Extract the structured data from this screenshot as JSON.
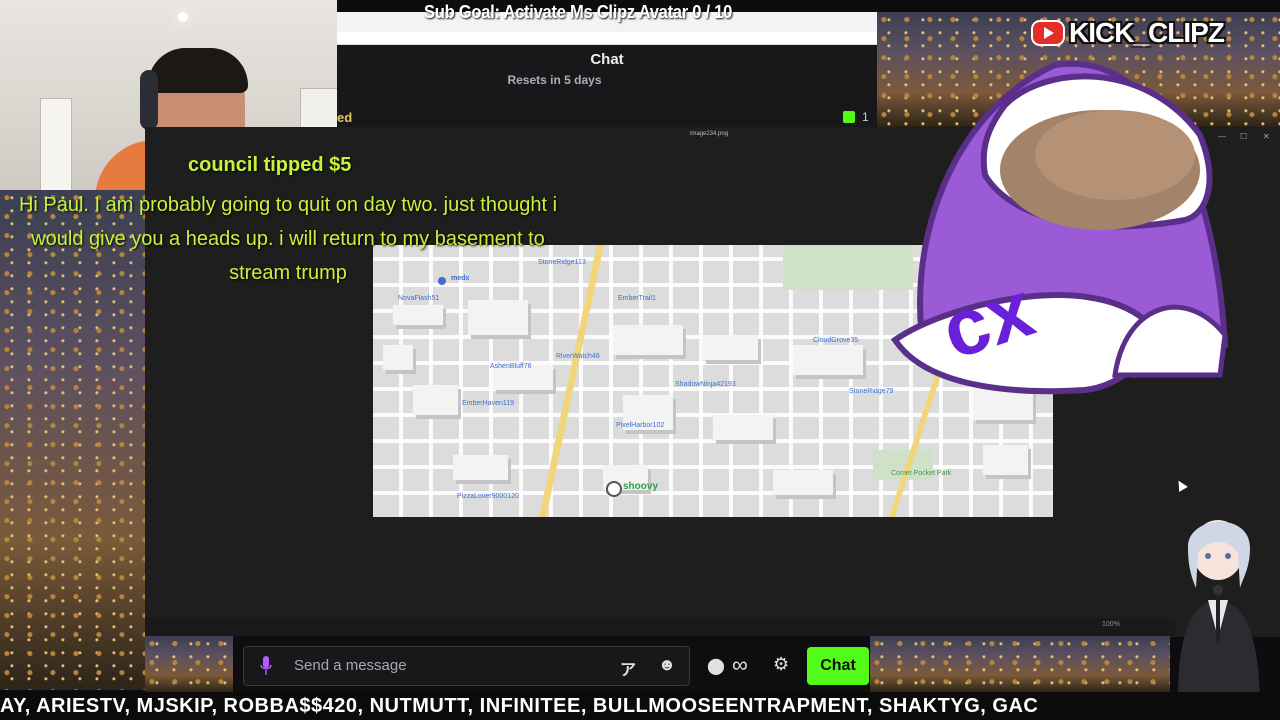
{
  "stream": {
    "sub_goal": "Sub Goal: Activate Ms Clipz Avatar  0 / 10",
    "logo_text": "KICK_CLIPZ",
    "tip_title": "council tipped $5",
    "tip_message": "Hi Paul. I am probably going to quit on day two. just thought i would give you a heads up. i will return to my basement to stream trump",
    "beanie_text": "cx",
    "ticker": "AY, ARIESTV, MJSKIP, ROBBA$$420, NUTMUTT, INFINITEE, BULLMOOSEENTRAPMENT, SHAKTYG, GAC"
  },
  "chat_window": {
    "title": "Chat",
    "reset_text": "Resets in 5 days",
    "partial_text": "ed",
    "gift_count": "1"
  },
  "viewer": {
    "filename": "image234.png",
    "zoom": "100%"
  },
  "map": {
    "labels": [
      {
        "text": "StoneRidge113"
      },
      {
        "text": "NovaFlash51"
      },
      {
        "text": "EmberTrail1"
      },
      {
        "text": "medx"
      },
      {
        "text": "RiverWatch48"
      },
      {
        "text": "AshenBluff76"
      },
      {
        "text": "CloudGrove35"
      },
      {
        "text": "ShadowNinja42193"
      },
      {
        "text": "StoneRidge79"
      },
      {
        "text": "EmberHaven119"
      },
      {
        "text": "PixelHarbor102"
      },
      {
        "text": "Comet Pocket Park"
      },
      {
        "text": "PizzaLover9000120"
      }
    ],
    "player_name": "shoovy"
  },
  "chat_input": {
    "placeholder": "Send a message",
    "send_label": "Chat",
    "icons": [
      "mic-icon",
      "translate-icon",
      "emoji-icon",
      "users-icon",
      "infinity-icon",
      "gear-icon"
    ]
  },
  "colors": {
    "kick_green": "#53fc18",
    "tip_yellow": "#c8f23a",
    "beanie_purple": "#9b5bd6"
  }
}
